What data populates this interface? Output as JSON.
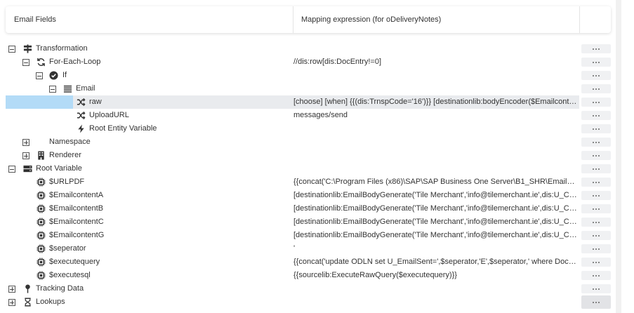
{
  "header": {
    "fields_label": "Email Fields",
    "mapping_label": "Mapping expression (for oDeliveryNotes)"
  },
  "rows": [
    {
      "label": "Transformation",
      "icon": "signpost-icon",
      "toggle": "minus",
      "mapping": ""
    },
    {
      "label": "For-Each-Loop",
      "icon": "loop-icon",
      "toggle": "minus",
      "mapping": "//dis:row[dis:DocEntry!=0]"
    },
    {
      "label": "If",
      "icon": "check-circle-icon",
      "toggle": "minus",
      "mapping": ""
    },
    {
      "label": "Email",
      "icon": "list-icon",
      "toggle": "minus",
      "mapping": ""
    },
    {
      "label": "raw",
      "icon": "shuffle-icon",
      "toggle": "",
      "mapping": "[choose] [when] {{(dis:TrnspCode='16')}} [destinationlib:bodyEncoder($Emailcontent..."
    },
    {
      "label": "UploadURL",
      "icon": "shuffle-icon",
      "toggle": "",
      "mapping": "messages/send"
    },
    {
      "label": "Root Entity Variable",
      "icon": "bolt-icon",
      "toggle": "",
      "mapping": ""
    },
    {
      "label": "Namespace",
      "icon": "",
      "toggle": "plus",
      "mapping": ""
    },
    {
      "label": "Renderer",
      "icon": "building-icon",
      "toggle": "plus",
      "mapping": ""
    },
    {
      "label": "Root Variable",
      "icon": "server-icon",
      "toggle": "minus",
      "mapping": ""
    },
    {
      "label": "$URLPDF",
      "icon": "chip-icon",
      "toggle": "",
      "mapping": "{{concat('C:\\Program Files (x86)\\SAP\\SAP Business One Server\\B1_SHR\\EmailDocs..."
    },
    {
      "label": "$EmailcontentA",
      "icon": "chip-icon",
      "toggle": "",
      "mapping": "[destinationlib:EmailBodyGenerate('Tile Merchant','info@tilemerchant.ie',dis:U_Cust..."
    },
    {
      "label": "$EmailcontentB",
      "icon": "chip-icon",
      "toggle": "",
      "mapping": "[destinationlib:EmailBodyGenerate('Tile Merchant','info@tilemerchant.ie',dis:U_Cust..."
    },
    {
      "label": "$EmailcontentC",
      "icon": "chip-icon",
      "toggle": "",
      "mapping": "[destinationlib:EmailBodyGenerate('Tile Merchant','info@tilemerchant.ie',dis:U_Cust..."
    },
    {
      "label": "$EmailcontentG",
      "icon": "chip-icon",
      "toggle": "",
      "mapping": "[destinationlib:EmailBodyGenerate('Tile Merchant','info@tilemerchant.ie',dis:U_Cust..."
    },
    {
      "label": "$seperator",
      "icon": "chip-icon",
      "toggle": "",
      "mapping": "'"
    },
    {
      "label": "$executequery",
      "icon": "chip-icon",
      "toggle": "",
      "mapping": "{{concat('update ODLN set U_EmailSent=',$seperator,'E',$seperator,' where DocEnt..."
    },
    {
      "label": "$executesql",
      "icon": "chip-icon",
      "toggle": "",
      "mapping": "{{sourcelib:ExecuteRawQuery($executequery)}}"
    },
    {
      "label": "Tracking Data",
      "icon": "pin-icon",
      "toggle": "plus",
      "mapping": ""
    },
    {
      "label": "Lookups",
      "icon": "hourglass-icon",
      "toggle": "plus",
      "mapping": ""
    }
  ]
}
